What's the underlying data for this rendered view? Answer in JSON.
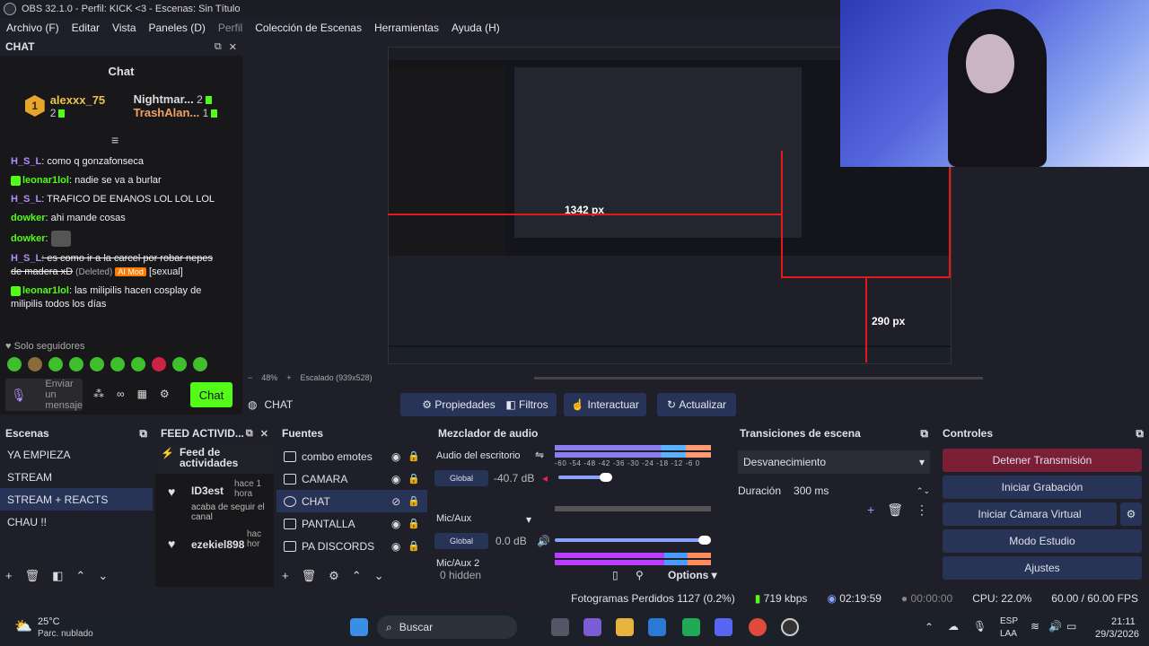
{
  "window": {
    "title": "OBS 32.1.0 - Perfil: KICK <3 - Escenas: Sin Título"
  },
  "menu": [
    "Archivo (F)",
    "Editar",
    "Vista",
    "Paneles (D)",
    "Perfil",
    "Colección de Escenas",
    "Herramientas",
    "Ayuda (H)"
  ],
  "chat_dock": {
    "dock_title": "CHAT",
    "title": "Chat",
    "gifters": [
      {
        "rank": "1",
        "name": "alexxx_75",
        "count": "2"
      },
      {
        "name": "Nightmar...",
        "count": "2"
      },
      {
        "name": "TrashAlan...",
        "count": "1"
      }
    ],
    "messages": [
      {
        "user": "H_S_L",
        "text": ": como q gonzafonseca"
      },
      {
        "user": "leonar1lol",
        "text": ": nadie se va a burlar"
      },
      {
        "user": "H_S_L",
        "text": ": TRAFICO DE ENANOS LOL LOL LOL"
      },
      {
        "user": "dowker",
        "text": ": ahi mande cosas"
      },
      {
        "user": "dowker",
        "text": ":"
      },
      {
        "user": "H_S_L",
        "text": ": es como ir a la carcel por robar nepes de madera xD",
        "deleted": "(Deleted)",
        "mod": "AI Mod",
        "tag": "[sexual]"
      },
      {
        "user": "leonar1lol",
        "text": ": las milipilis hacen cosplay de milipilis todos los días"
      }
    ],
    "followers_only": "Solo seguidores",
    "input_placeholder": "Enviar un mensaje",
    "infinity": "∞",
    "send_label": "Chat"
  },
  "preview": {
    "measure_w": "1342 px",
    "measure_h": "290 px"
  },
  "scale_bar": {
    "zoom": "48%",
    "scaled": "Escalado (939x528)"
  },
  "source_toolbar": {
    "current": "CHAT",
    "buttons": [
      "Propiedades",
      "Filtros",
      "Interactuar",
      "Actualizar"
    ]
  },
  "scenes": {
    "title": "Escenas",
    "items": [
      "YA EMPIEZA",
      "STREAM",
      "STREAM + REACTS",
      "CHAU !!"
    ],
    "selected": 2
  },
  "feed": {
    "title": "FEED ACTIVID...",
    "header": "Feed de actividades",
    "items": [
      {
        "user": "ID3est",
        "time": "hace 1 hora",
        "action": "acaba de seguir el canal"
      },
      {
        "user": "ezekiel898",
        "time": "hac hor"
      }
    ]
  },
  "sources": {
    "title": "Fuentes",
    "items": [
      "combo emotes",
      "CAMARA",
      "CHAT",
      "PANTALLA",
      "PA DISCORDS"
    ],
    "selected": 2
  },
  "mixer": {
    "title": "Mezclador de audio",
    "channels": [
      {
        "name": "Audio del escritorio",
        "global": "Global",
        "db": "-40.7 dB"
      },
      {
        "name": "Mic/Aux",
        "global": "Global",
        "db": "0.0 dB"
      },
      {
        "name": "Mic/Aux 2"
      }
    ],
    "ticks": "-60 -54 -48 -42 -36 -30 -24 -18 -12 -6 0",
    "hidden": "0 hidden",
    "options": "Options"
  },
  "transitions": {
    "title": "Transiciones de escena",
    "type": "Desvanecimiento",
    "duration_label": "Duración",
    "duration": "300 ms"
  },
  "controls": {
    "title": "Controles",
    "buttons": [
      "Detener Transmisión",
      "Iniciar Grabación",
      "Iniciar Cámara Virtual",
      "Modo Estudio",
      "Ajustes"
    ]
  },
  "statusbar": {
    "frames": "Fotogramas Perdidos 1127 (0.2%)",
    "kbps": "719 kbps",
    "live_time": "02:19:59",
    "rec_time": "00:00:00",
    "cpu": "CPU: 22.0%",
    "fps": "60.00 / 60.00 FPS"
  },
  "taskbar": {
    "weather_temp": "25°C",
    "weather_desc": "Parc. nublado",
    "search": "Buscar",
    "lang": "ESP",
    "lang2": "LAA",
    "time": "21:11",
    "date": "29/3/2026"
  },
  "colors": {
    "accent": "#283358",
    "kick_green": "#53fc18",
    "stop_stream": "#7a1f36",
    "measure_red": "#e21a1a"
  }
}
